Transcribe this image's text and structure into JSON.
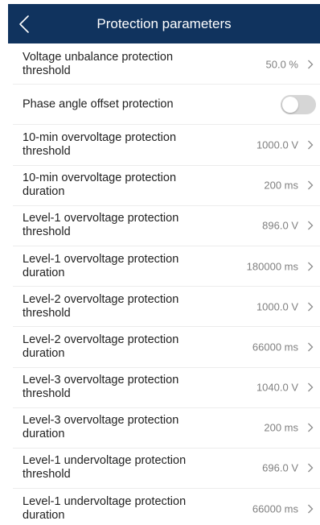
{
  "header": {
    "title": "Protection parameters",
    "back_icon": "chevron-left-icon",
    "background_color": "#10335e"
  },
  "rows": [
    {
      "label": "Voltage unbalance protection threshold",
      "value": "50.0 %"
    },
    {
      "label": "Phase angle offset protection",
      "toggle": "off"
    },
    {
      "label": "10-min overvoltage protection threshold",
      "value": "1000.0 V"
    },
    {
      "label": "10-min overvoltage protection duration",
      "value": "200 ms"
    },
    {
      "label": "Level-1 overvoltage protection threshold",
      "value": "896.0 V"
    },
    {
      "label": "Level-1 overvoltage protection duration",
      "value": "180000 ms"
    },
    {
      "label": "Level-2 overvoltage protection threshold",
      "value": "1000.0 V"
    },
    {
      "label": "Level-2 overvoltage protection duration",
      "value": "66000 ms"
    },
    {
      "label": "Level-3 overvoltage protection threshold",
      "value": "1040.0 V"
    },
    {
      "label": "Level-3 overvoltage protection duration",
      "value": "200 ms"
    },
    {
      "label": "Level-1 undervoltage protection threshold",
      "value": "696.0 V"
    },
    {
      "label": "Level-1 undervoltage protection duration",
      "value": "66000 ms"
    }
  ]
}
